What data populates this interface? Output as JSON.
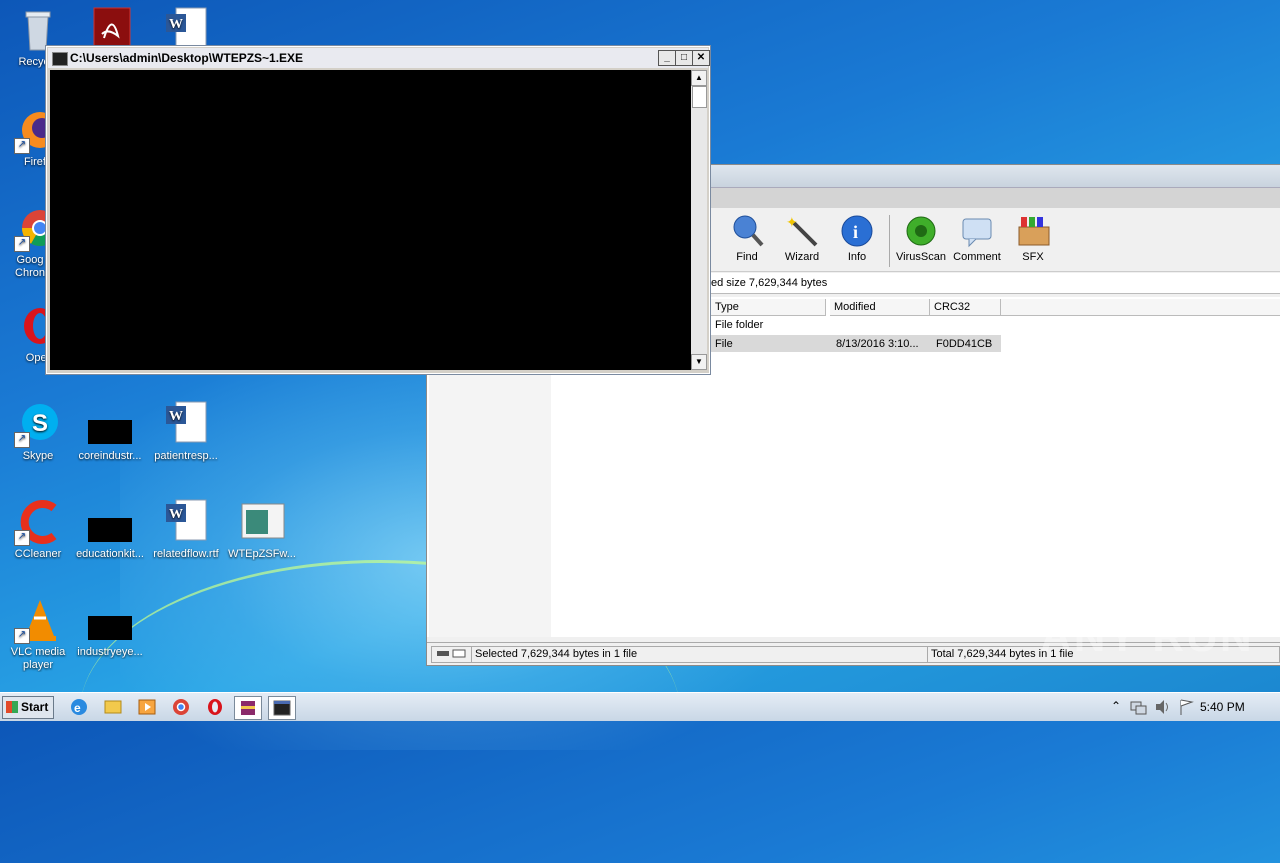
{
  "desktop": {
    "icons": [
      {
        "label": "Recycle",
        "icon": "recycle-bin-icon"
      },
      {
        "label": "",
        "icon": "acrobat-icon"
      },
      {
        "label": "",
        "icon": "word-doc-icon"
      },
      {
        "label": "Firefo",
        "icon": "firefox-icon"
      },
      {
        "label": "Goog Chron",
        "icon": "chrome-icon"
      },
      {
        "label": "Oper",
        "icon": "opera-icon"
      },
      {
        "label": "Skype",
        "icon": "skype-icon"
      },
      {
        "label": "coreindustr...",
        "icon": "black-file-icon"
      },
      {
        "label": "patientresp...",
        "icon": "word-doc-icon"
      },
      {
        "label": "CCleaner",
        "icon": "ccleaner-icon"
      },
      {
        "label": "educationkit...",
        "icon": "black-file-icon"
      },
      {
        "label": "relatedflow.rtf",
        "icon": "word-doc-icon"
      },
      {
        "label": "WTEpZSFw...",
        "icon": "exe-window-icon"
      },
      {
        "label": "VLC media player",
        "icon": "vlc-icon"
      },
      {
        "label": "industryeye...",
        "icon": "black-file-icon"
      }
    ],
    "watermark": "ANY RUN"
  },
  "console": {
    "title": "C:\\Users\\admin\\Desktop\\WTEPZS~1.EXE",
    "minimize": "_",
    "maximize": "□",
    "close": "✕",
    "scroll_up": "▲",
    "scroll_down": "▼"
  },
  "winrar": {
    "toolbar": [
      {
        "label": "Find",
        "icon": "find-icon"
      },
      {
        "label": "Wizard",
        "icon": "wizard-icon"
      },
      {
        "label": "Info",
        "icon": "info-icon"
      },
      {
        "label": "VirusScan",
        "icon": "virusscan-icon"
      },
      {
        "label": "Comment",
        "icon": "comment-icon"
      },
      {
        "label": "SFX",
        "icon": "sfx-icon"
      }
    ],
    "path_info": "ed size 7,629,344 bytes",
    "columns": [
      "Type",
      "Modified",
      "CRC32"
    ],
    "rows": [
      {
        "type": "File folder",
        "modified": "",
        "crc": ""
      },
      {
        "type": "File",
        "modified": "8/13/2016 3:10...",
        "crc": "F0DD41CB"
      }
    ],
    "status_left": "Selected 7,629,344 bytes in 1 file",
    "status_right": "Total 7,629,344 bytes in 1 file"
  },
  "taskbar": {
    "start_label": "Start",
    "apps": [
      "ie-icon",
      "explorer-icon",
      "media-player-icon",
      "chrome-icon",
      "opera-icon",
      "winrar-icon",
      "console-icon"
    ],
    "tray_icons": [
      "tray-expand-icon",
      "network-icon",
      "volume-icon",
      "flag-icon"
    ],
    "tray_expand": "⌃",
    "clock": "5:40 PM"
  },
  "colors": {
    "desktop_blue": "#1a7ad4",
    "console_bg": "#000000",
    "selection_gray": "#d9d9d9"
  }
}
